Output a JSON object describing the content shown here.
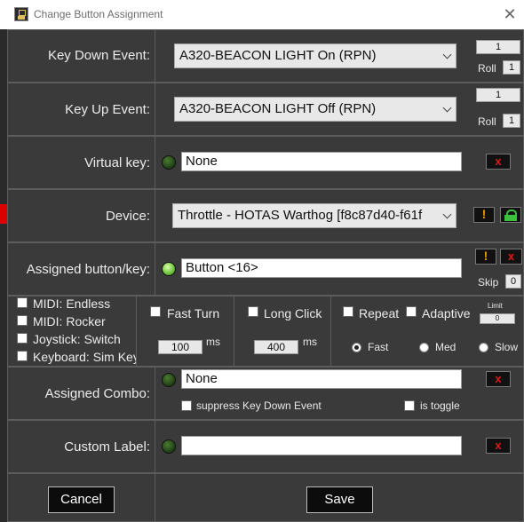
{
  "window": {
    "title": "Change Button Assignment"
  },
  "key_down": {
    "label": "Key Down Event:",
    "value": "A320-BEACON LIGHT On (RPN)",
    "repeat_count": "1",
    "roll_label": "Roll",
    "roll_value": "1"
  },
  "key_up": {
    "label": "Key Up Event:",
    "value": "A320-BEACON LIGHT Off (RPN)",
    "repeat_count": "1",
    "roll_label": "Roll",
    "roll_value": "1"
  },
  "virtual_key": {
    "label": "Virtual key:",
    "value": "None",
    "clear": "x"
  },
  "device": {
    "label": "Device:",
    "value": "Throttle - HOTAS Warthog [f8c87d40-f61f",
    "warn": "!"
  },
  "assigned_button": {
    "label": "Assigned button/key:",
    "value": "Button <16>",
    "warn": "!",
    "clear": "x",
    "skip_label": "Skip",
    "skip_value": "0"
  },
  "options": {
    "checkboxes": [
      "MIDI: Endless",
      "MIDI: Rocker",
      "Joystick: Switch",
      "Keyboard: Sim Key"
    ],
    "fast_turn": {
      "label": "Fast Turn",
      "value": "100",
      "unit": "ms"
    },
    "long_click": {
      "label": "Long Click",
      "value": "400",
      "unit": "ms"
    },
    "repeat": {
      "label": "Repeat"
    },
    "adaptive": {
      "label": "Adaptive"
    },
    "limit": {
      "label": "Limit",
      "value": "0"
    },
    "speed": [
      "Fast",
      "Med",
      "Slow"
    ]
  },
  "assigned_combo": {
    "label": "Assigned Combo:",
    "value": "None",
    "clear": "x",
    "suppress_label": "suppress Key Down Event",
    "toggle_label": "is toggle"
  },
  "custom_label": {
    "label": "Custom Label:",
    "value": "",
    "clear": "x"
  },
  "buttons": {
    "cancel": "Cancel",
    "save": "Save"
  },
  "colors": {
    "led_active": "#6bc03a",
    "led_inactive": "#2e5a20",
    "clear_red": "#e01818",
    "warn_orange": "#e09a0a",
    "lock_green": "#3fbf3f"
  }
}
